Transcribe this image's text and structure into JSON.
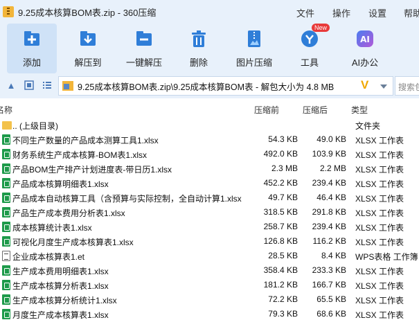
{
  "window": {
    "title": "9.25成本核算BOM表.zip - 360压缩",
    "menu": [
      "文件",
      "操作",
      "设置",
      "帮助"
    ]
  },
  "toolbar": {
    "buttons": [
      {
        "label": "添加",
        "icon": "add-file-icon"
      },
      {
        "label": "解压到",
        "icon": "extract-to-icon"
      },
      {
        "label": "一键解压",
        "icon": "one-click-extract-icon"
      },
      {
        "label": "删除",
        "icon": "trash-icon"
      },
      {
        "label": "图片压缩",
        "icon": "image-compress-icon"
      },
      {
        "label": "工具",
        "icon": "tools-icon",
        "badge": "New"
      },
      {
        "label": "AI办公",
        "icon": "ai-icon"
      }
    ]
  },
  "address": {
    "path": "9.25成本核算BOM表.zip\\9.25成本核算BOM表 - 解包大小为 4.8 MB",
    "search_placeholder": "搜索包"
  },
  "columns": {
    "name": "名称",
    "compressed_before": "压缩前",
    "compressed_after": "压缩后",
    "type": "类型"
  },
  "rows": [
    {
      "name": ".. (上级目录)",
      "before": "",
      "after": "",
      "type": "文件夹",
      "icon": "folder"
    },
    {
      "name": "不同生产数量的产品成本测算工具1.xlsx",
      "before": "54.3 KB",
      "after": "49.0 KB",
      "type": "XLSX 工作表",
      "icon": "xlsx"
    },
    {
      "name": "财务系统生产成本核算-BOM表1.xlsx",
      "before": "492.0 KB",
      "after": "103.9 KB",
      "type": "XLSX 工作表",
      "icon": "xlsx"
    },
    {
      "name": "产品BOM生产排产计划进度表-带日历1.xlsx",
      "before": "2.3 MB",
      "after": "2.2 MB",
      "type": "XLSX 工作表",
      "icon": "xlsx"
    },
    {
      "name": "产品成本核算明细表1.xlsx",
      "before": "452.2 KB",
      "after": "239.4 KB",
      "type": "XLSX 工作表",
      "icon": "xlsx"
    },
    {
      "name": "产品成本自动核算工具（含预算与实际控制，全自动计算1.xlsx",
      "before": "49.7 KB",
      "after": "46.4 KB",
      "type": "XLSX 工作表",
      "icon": "xlsx"
    },
    {
      "name": "产品生产成本费用分析表1.xlsx",
      "before": "318.5 KB",
      "after": "291.8 KB",
      "type": "XLSX 工作表",
      "icon": "xlsx"
    },
    {
      "name": "成本核算统计表1.xlsx",
      "before": "258.7 KB",
      "after": "239.4 KB",
      "type": "XLSX 工作表",
      "icon": "xlsx"
    },
    {
      "name": "可视化月度生产成本核算表1.xlsx",
      "before": "126.8 KB",
      "after": "116.2 KB",
      "type": "XLSX 工作表",
      "icon": "xlsx"
    },
    {
      "name": "企业成本核算表1.et",
      "before": "28.5 KB",
      "after": "8.4 KB",
      "type": "WPS表格 工作簿",
      "icon": "et"
    },
    {
      "name": "生产成本费用明细表1.xlsx",
      "before": "358.4 KB",
      "after": "233.3 KB",
      "type": "XLSX 工作表",
      "icon": "xlsx"
    },
    {
      "name": "生产成本核算分析表1.xlsx",
      "before": "181.2 KB",
      "after": "166.7 KB",
      "type": "XLSX 工作表",
      "icon": "xlsx"
    },
    {
      "name": "生产成本核算分析统计1.xlsx",
      "before": "72.2 KB",
      "after": "65.5 KB",
      "type": "XLSX 工作表",
      "icon": "xlsx"
    },
    {
      "name": "月度生产成本核算表1.xlsx",
      "before": "79.3 KB",
      "after": "68.6 KB",
      "type": "XLSX 工作表",
      "icon": "xlsx"
    }
  ],
  "colors": {
    "chrome_bg": "#e8f1fb",
    "accent_blue": "#2f7ed8",
    "xlsx_green": "#1d9a4a",
    "folder_yellow": "#f3c24c"
  }
}
